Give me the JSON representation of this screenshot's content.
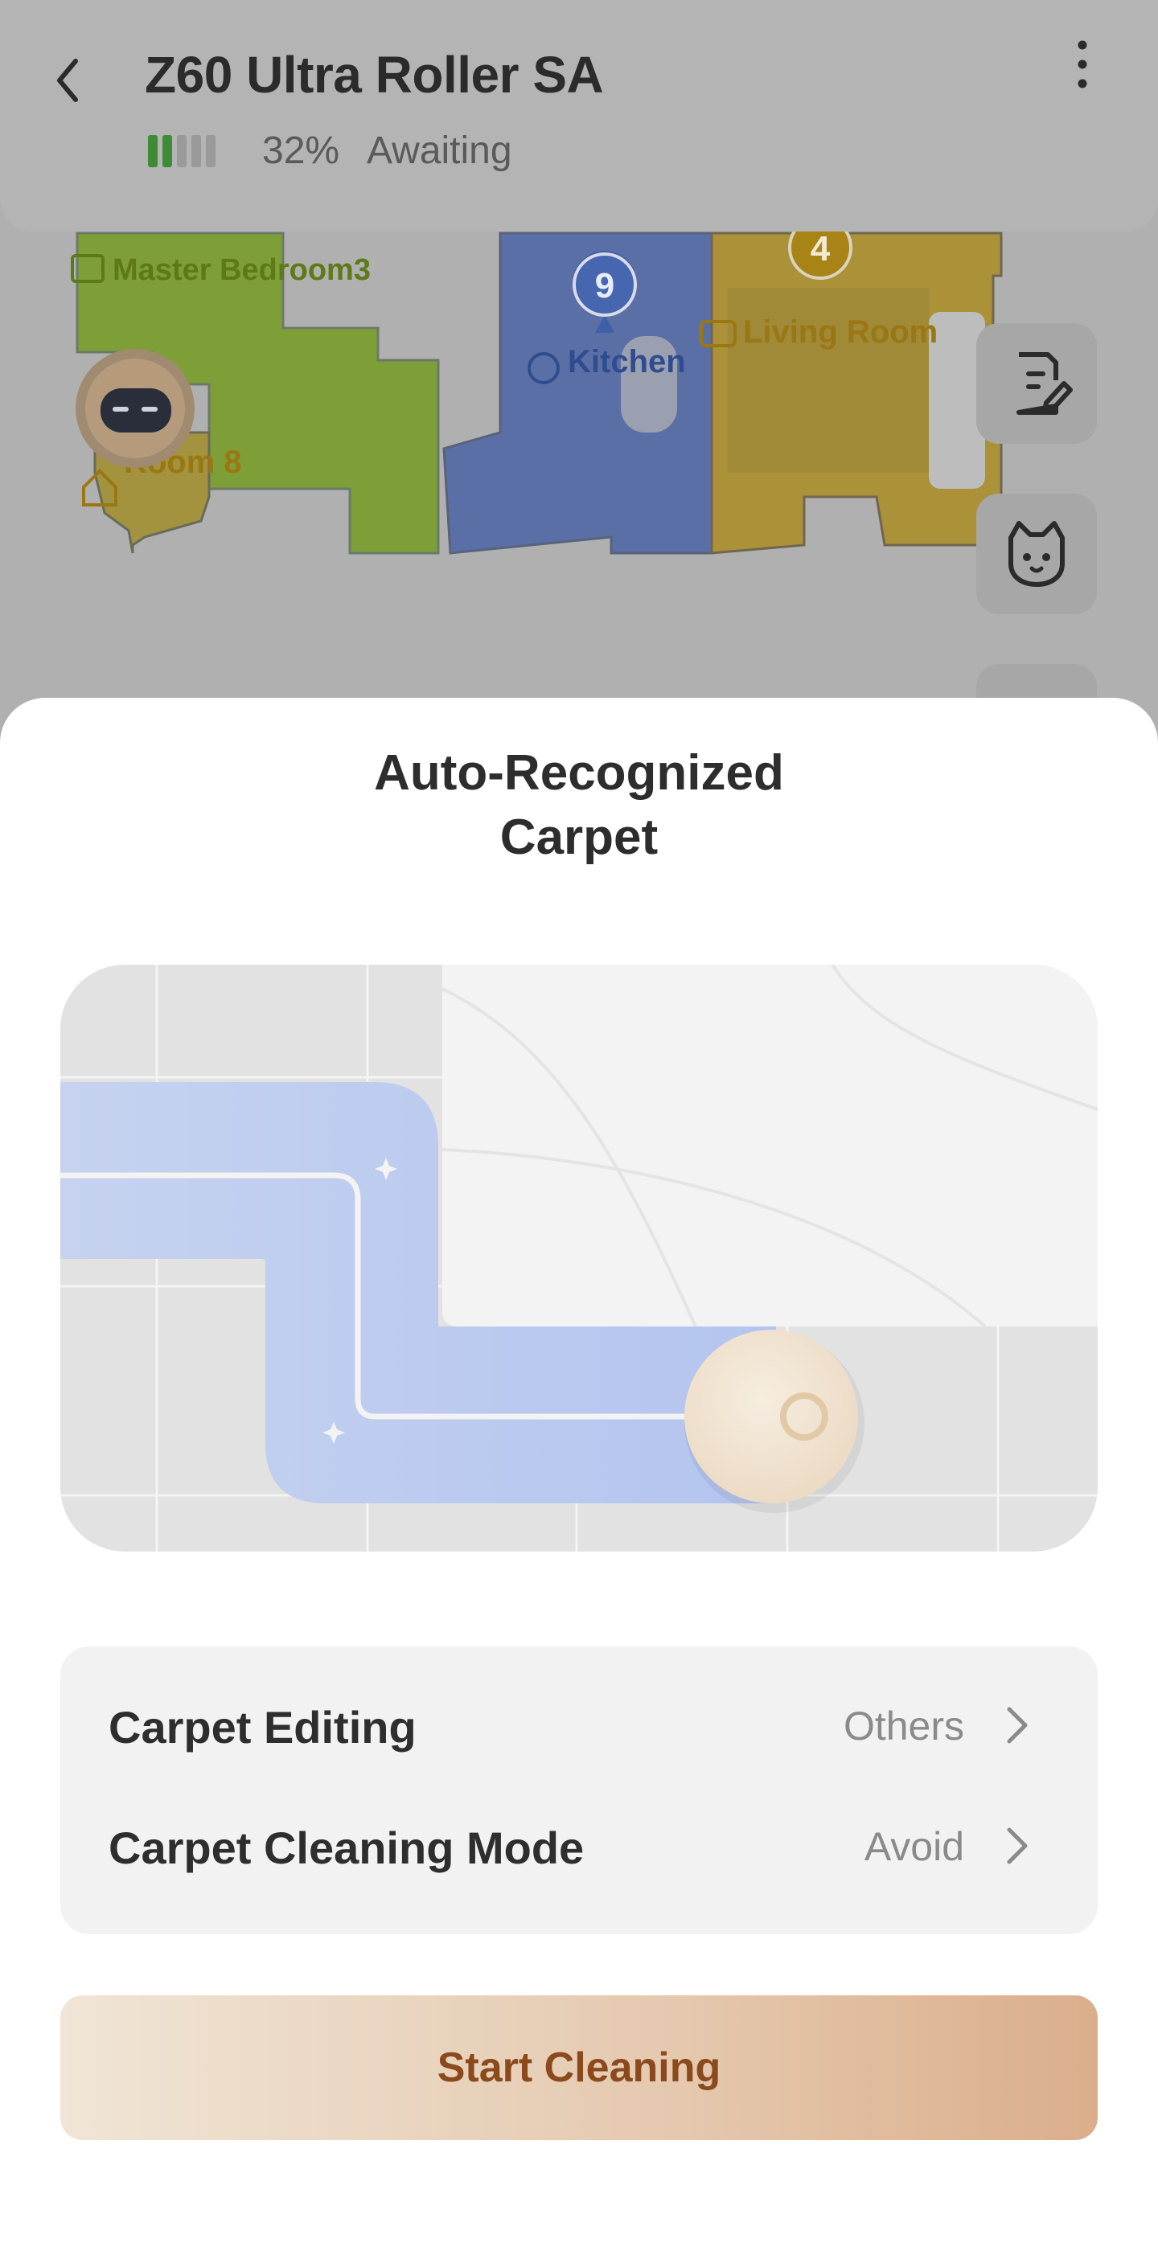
{
  "header": {
    "device_name": "Z60 Ultra Roller SA",
    "battery_percent": "32%",
    "battery_level": 0.32,
    "status": "Awaiting"
  },
  "map": {
    "rooms": [
      {
        "label": "Master Bedroom3",
        "color": "#7fa12f"
      },
      {
        "label": "Kitchen",
        "color": "#3f5fa8",
        "order": "9"
      },
      {
        "label": "Living Room",
        "color": "#b58f1e",
        "order": "4"
      },
      {
        "label": "Room 8",
        "color": "#b58f1e"
      }
    ],
    "side_buttons": [
      "edit-map-icon",
      "pet-icon"
    ]
  },
  "sheet": {
    "title_line1": "Auto-Recognized",
    "title_line2": "Carpet",
    "settings": [
      {
        "label": "Carpet Editing",
        "value": "Others"
      },
      {
        "label": "Carpet Cleaning Mode",
        "value": "Avoid"
      }
    ],
    "start_button": "Start Cleaning"
  },
  "colors": {
    "accent_text": "#8a4a1c",
    "button_gradient_start": "#f0e5d6",
    "button_gradient_end": "#dbae8b",
    "path_blue": "#b8c7ef"
  }
}
